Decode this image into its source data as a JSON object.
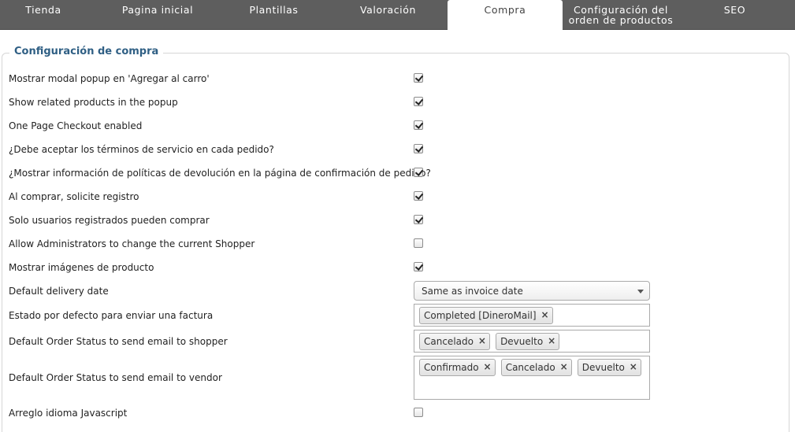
{
  "tabs": [
    {
      "label": "Tienda",
      "active": false
    },
    {
      "label": "Pagina inicial",
      "active": false
    },
    {
      "label": "Plantillas",
      "active": false
    },
    {
      "label": "Valoración",
      "active": false
    },
    {
      "label": "Compra",
      "active": true
    },
    {
      "label": "Configuración del orden de productos",
      "active": false
    },
    {
      "label": "SEO",
      "active": false
    }
  ],
  "section": {
    "title": "Configuración de compra"
  },
  "settings": [
    {
      "label": "Mostrar modal popup en 'Agregar al carro'",
      "checked": true
    },
    {
      "label": "Show related products in the popup",
      "checked": true
    },
    {
      "label": "One Page Checkout enabled",
      "checked": true
    },
    {
      "label": "¿Debe aceptar los términos de servicio en cada pedido?",
      "checked": true
    },
    {
      "label": "¿Mostrar información de políticas de devolución en la página de confirmación de pedido?",
      "checked": true
    },
    {
      "label": "Al comprar, solicite registro",
      "checked": true
    },
    {
      "label": "Solo usuarios registrados pueden comprar",
      "checked": true
    },
    {
      "label": "Allow Administrators to change the current Shopper",
      "checked": false
    },
    {
      "label": "Mostrar imágenes de producto",
      "checked": true
    }
  ],
  "delivery": {
    "label": "Default delivery date",
    "value": "Same as invoice date"
  },
  "invoice_status": {
    "label": "Estado por defecto para enviar una factura",
    "chips": [
      "Completed [DineroMail]"
    ]
  },
  "shopper_status": {
    "label": "Default Order Status to send email to shopper",
    "chips": [
      "Cancelado",
      "Devuelto"
    ]
  },
  "vendor_status": {
    "label": "Default Order Status to send email to vendor",
    "chips": [
      "Confirmado",
      "Cancelado",
      "Devuelto"
    ]
  },
  "js_fix": {
    "label": "Arreglo idioma Javascript",
    "checked": false
  },
  "icons": {
    "remove": "×",
    "dropdown": "chevron-down-icon",
    "check": "checkmark-icon"
  }
}
